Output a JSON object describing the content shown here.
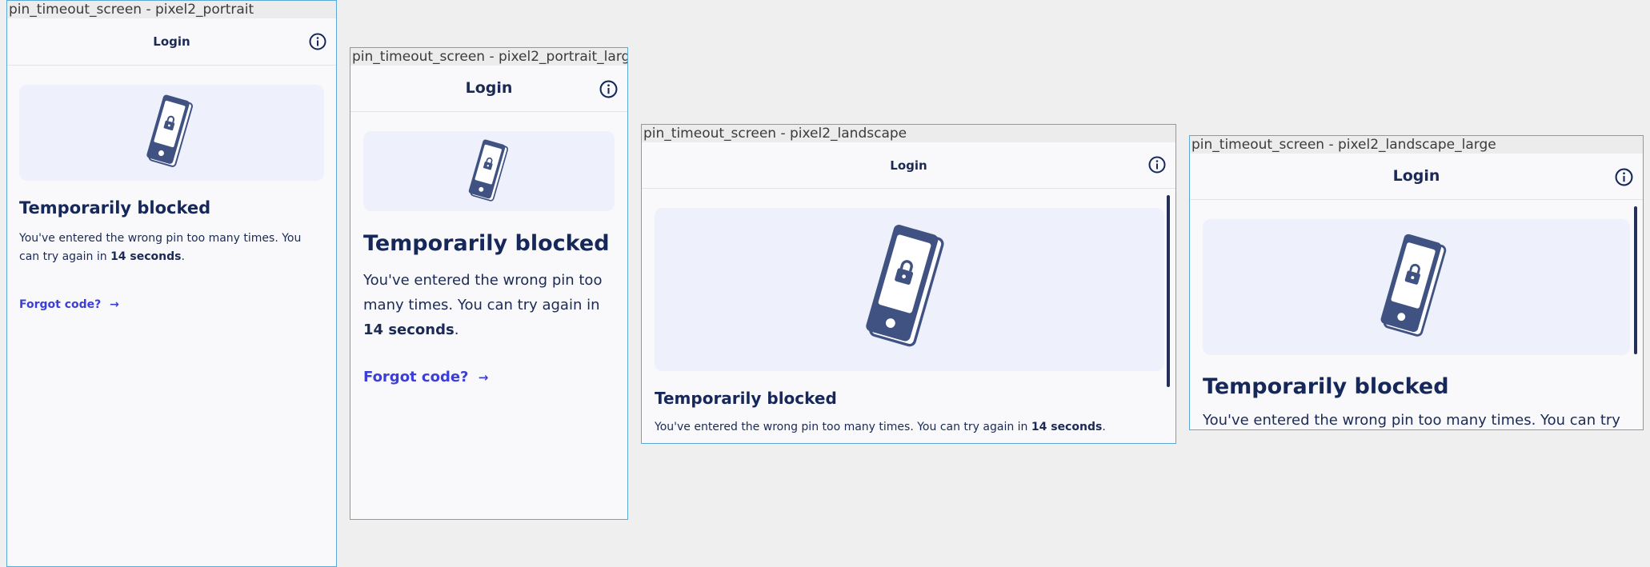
{
  "frames": [
    {
      "label": "pin_timeout_screen - pixel2_portrait",
      "title": "Login",
      "heading": "Temporarily blocked",
      "message_pre": "You've entered the wrong pin too many times. You can try again in ",
      "message_bold": "14 seconds",
      "message_post": ".",
      "link": "Forgot code?"
    },
    {
      "label": "pin_timeout_screen - pixel2_portrait_large",
      "title": "Login",
      "heading": "Temporarily blocked",
      "message_pre": "You've entered the wrong pin too many times. You can try again in ",
      "message_bold": "14 seconds",
      "message_post": ".",
      "link": "Forgot code?"
    },
    {
      "label": "pin_timeout_screen - pixel2_landscape",
      "title": "Login",
      "heading": "Temporarily blocked",
      "message_pre": "You've entered the wrong pin too many times. You can try again in ",
      "message_bold": "14 seconds",
      "message_post": "."
    },
    {
      "label": "pin_timeout_screen - pixel2_landscape_large",
      "title": "Login",
      "heading": "Temporarily blocked",
      "message_pre": "You've entered the wrong pin too many times. You can try"
    }
  ],
  "colors": {
    "accent": "#3b3fd8",
    "text_dark": "#16285a",
    "illustration": "#3f5282",
    "hero_bg": "#eef1fb",
    "frame_border": "#5aa9d8"
  }
}
